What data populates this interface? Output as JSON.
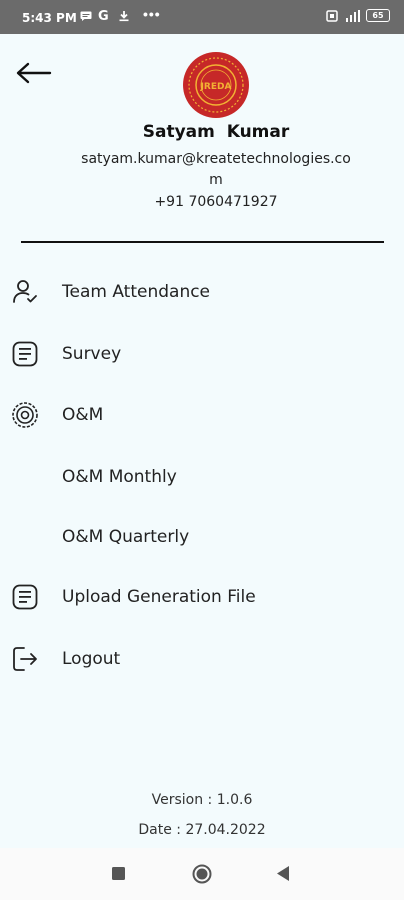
{
  "status": {
    "time": "5:43 PM",
    "icons": [
      "message-icon",
      "google-icon",
      "download-icon",
      "more-icon"
    ],
    "battery": "65"
  },
  "profile": {
    "name": "Satyam  Kumar",
    "email": "satyam.kumar@kreatetechnologies.com",
    "phone": "+91 7060471927",
    "logo_text": "JREDA"
  },
  "menu": [
    {
      "label": "Team Attendance",
      "icon": "person-check-icon"
    },
    {
      "label": "Survey",
      "icon": "document-icon"
    },
    {
      "label": "O&M",
      "icon": "gear-icon"
    },
    {
      "label": "O&M Monthly",
      "icon": ""
    },
    {
      "label": "O&M Quarterly",
      "icon": ""
    },
    {
      "label": "Upload Generation File",
      "icon": "document-icon"
    },
    {
      "label": "Logout",
      "icon": "logout-icon"
    }
  ],
  "footer": {
    "version": "Version : 1.0.6",
    "date": "Date : 27.04.2022"
  },
  "colors": {
    "background": "#f3fbfd",
    "statusbar": "#6b6b6b",
    "logo_red": "#c62828",
    "logo_gold": "#f2b233"
  }
}
